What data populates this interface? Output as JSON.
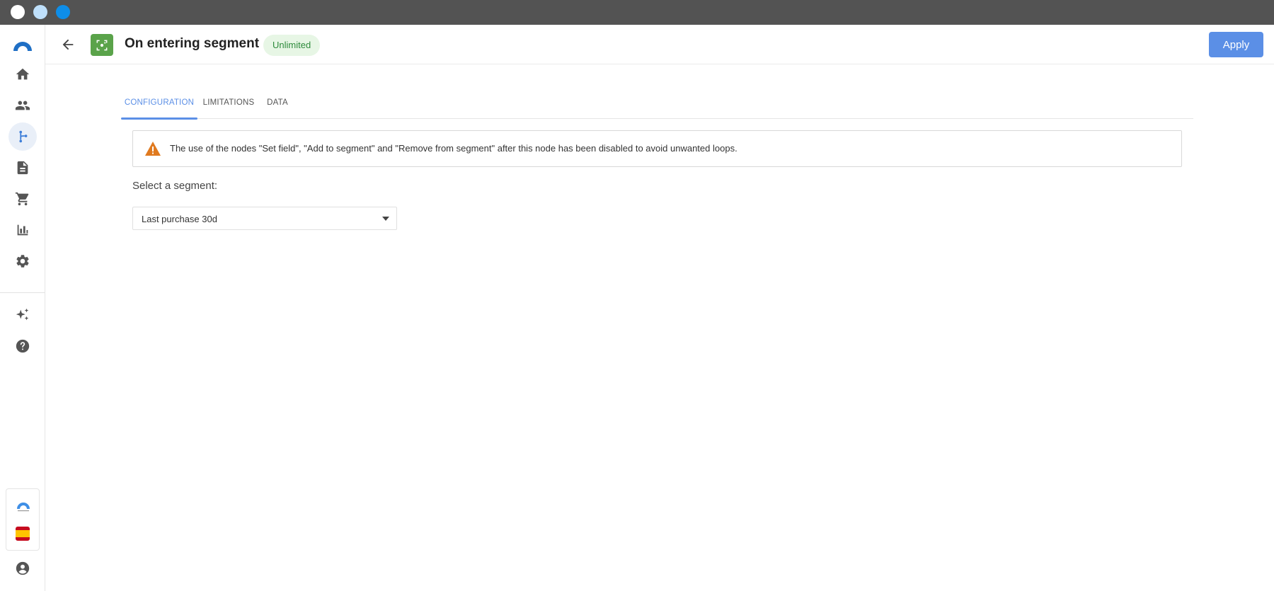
{
  "app": {
    "brand_logo": "arc-logo",
    "accent_color": "#5b8fe6"
  },
  "sidebar": {
    "items": [
      {
        "icon": "home-icon",
        "active": false
      },
      {
        "icon": "people-icon",
        "active": false
      },
      {
        "icon": "flow-icon",
        "active": true
      },
      {
        "icon": "document-icon",
        "active": false
      },
      {
        "icon": "cart-icon",
        "active": false
      },
      {
        "icon": "bar-chart-icon",
        "active": false
      },
      {
        "icon": "gear-icon",
        "active": false
      },
      {
        "icon": "sparkle-icon",
        "active": false
      },
      {
        "icon": "help-icon",
        "active": false
      }
    ],
    "bottom": [
      {
        "icon": "brand-logo-small"
      },
      {
        "icon": "spain-flag-icon"
      },
      {
        "icon": "account-icon"
      }
    ]
  },
  "header": {
    "title": "On entering segment",
    "badge": "Unlimited",
    "node_icon": "segment-node-icon",
    "node_color": "#5aa34a",
    "apply_label": "Apply"
  },
  "tabs": [
    {
      "label": "CONFIGURATION",
      "active": true
    },
    {
      "label": "LIMITATIONS",
      "active": false
    },
    {
      "label": "DATA",
      "active": false
    }
  ],
  "alert": {
    "icon": "warning-icon",
    "text": "The use of the nodes \"Set field\", \"Add to segment\" and \"Remove from segment\" after this node has been disabled to avoid unwanted loops."
  },
  "segment": {
    "label": "Select a segment:",
    "selected": "Last purchase 30d"
  }
}
